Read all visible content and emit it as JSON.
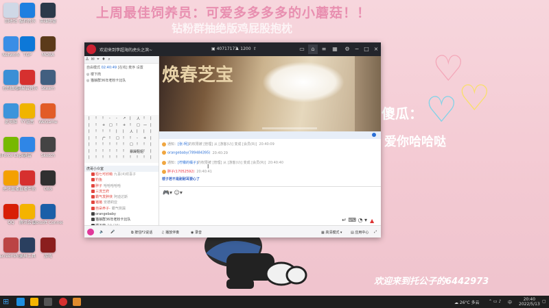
{
  "overlay": {
    "headline": "上周最佳饲养员：可爱多多多多的小蘑菇！！",
    "subline": "钻粉群抽绝版鸡屁股抱枕",
    "deco_line1": "傻瓜：",
    "deco_line2": "爱你哈哈哒",
    "welcome": "欢迎来到托公子的6442973",
    "heart_colors": [
      "#f4a7b9",
      "#7fd3e8",
      "#f9df6a"
    ]
  },
  "desktop_icons": [
    {
      "label": "回收站",
      "color": "#cfd8e6"
    },
    {
      "label": "酷狗音乐",
      "color": "#1e7fe0"
    },
    {
      "label": "英雄联盟",
      "color": "#2b3a4a"
    },
    {
      "label": "Network",
      "color": "#3a8ee6"
    },
    {
      "label": "TGP",
      "color": "#0d78d8"
    },
    {
      "label": "MOBA",
      "color": "#5b3a1a"
    },
    {
      "label": "控制面板",
      "color": "#3b8fd6"
    },
    {
      "label": "网易云音乐",
      "color": "#d6302f"
    },
    {
      "label": "Steam",
      "color": "#425f80"
    },
    {
      "label": "此电脑",
      "color": "#3d94db"
    },
    {
      "label": "YY语音",
      "color": "#f0b400"
    },
    {
      "label": "WeGame",
      "color": "#e25c27"
    },
    {
      "label": "GeForce Experience",
      "color": "#77b900"
    },
    {
      "label": "迅雷",
      "color": "#2f86e6"
    },
    {
      "label": "Sketch",
      "color": "#444"
    },
    {
      "label": "虎牙直播",
      "color": "#f4a000"
    },
    {
      "label": "直播伴侣",
      "color": "#d6302f"
    },
    {
      "label": "OBS",
      "color": "#303030"
    },
    {
      "label": "QQ",
      "color": "#d81e06"
    },
    {
      "label": "腾讯会议",
      "color": "#f4b300"
    },
    {
      "label": "Ubisoft Connect",
      "color": "#1b5fa8"
    },
    {
      "label": "screenshot",
      "color": "#b44"
    },
    {
      "label": "录屏工具",
      "color": "#2a3f5f"
    },
    {
      "label": "游戏",
      "color": "#8b1e1e"
    }
  ],
  "window": {
    "title": "欢迎来到李超海的虎头之滨~",
    "room_id": "40717173",
    "fans": "1200",
    "mode_label": "自由模式",
    "mode_time": "02:40:49",
    "mode_links": [
      "[在线]",
      "麦序",
      "设置"
    ],
    "channels": [
      "楼下肉",
      "猫娘群36年老粉卡比队"
    ],
    "grid_rows": [
      [
        "|",
        "!",
        "!",
        "-",
        "-",
        "↗",
        "|",
        "人",
        "!",
        "|"
      ],
      [
        "|",
        "!",
        "+",
        "□",
        "!",
        "+",
        "!",
        "□",
        "一",
        "|"
      ],
      [
        "|",
        "!",
        "!",
        "!",
        "|",
        "|",
        "人",
        "|",
        "|",
        "|"
      ],
      [
        "|",
        "!",
        "广",
        "!",
        "□",
        "!",
        "!",
        "-",
        "+",
        "|"
      ],
      [
        "|",
        "!",
        "!",
        "!",
        "!",
        "!",
        "□",
        "!",
        "!",
        "|"
      ],
      [
        "|",
        "!",
        "!",
        "!",
        "!",
        "!",
        "暴躁姐姐",
        "!",
        "!",
        "|"
      ],
      [
        "|",
        "!",
        "!",
        "!",
        "!",
        "!",
        "!",
        "!",
        "!",
        "|"
      ]
    ],
    "member_header": "虎哥小众室",
    "members": [
      {
        "name": "柏七可欣萌",
        "note": "九喜(4)欢喜子",
        "color": "#e2463f"
      },
      {
        "name": "钓鱼",
        "note": "",
        "color": "#e2463f"
      },
      {
        "name": "胖子",
        "note": "哈哈哈哈哈",
        "color": "#e2463f"
      },
      {
        "name": "三流王府",
        "note": "",
        "color": "#e2463f"
      },
      {
        "name": "霸气发胖侠",
        "note": "阿迪达斯",
        "color": "#e2463f"
      },
      {
        "name": "猪猪",
        "note": "安德莉亚",
        "color": "#e2463f"
      },
      {
        "name": "芭朵养子-",
        "note": "霸气侧漏",
        "color": "#e2463f"
      },
      {
        "name": "orangebaby",
        "note": "",
        "color": "#444"
      },
      {
        "name": "猫娘群36年老粉卡比队",
        "note": "",
        "color": "#444"
      },
      {
        "name": "楼下肉",
        "note": "7九(26)",
        "color": "#444"
      }
    ],
    "banner_title": "焕春芝宝",
    "chat": [
      {
        "prefix": "通知：",
        "name": "[张-柯]",
        "text": "的权限被 [管理] 从 [游客(U)] 变成 [会员(R)]",
        "time": "20:40:09"
      },
      {
        "prefix": "",
        "name": "orangebaby(789484395)",
        "text": "",
        "time": "20:40:29"
      },
      {
        "prefix": "通知：",
        "name": "[柠檬的橘子]",
        "text": "的权限被 [管理] 从 [游客(U)] 变成 [会员(R)]",
        "time": "20:40:40"
      },
      {
        "prefix": "",
        "name": "胖子(17052592)",
        "text": "",
        "time": "20:40:41"
      }
    ],
    "chat_message": "楼子若不是耐耐耳要心了",
    "bottom": {
      "mic": "按住F2说话",
      "music": "播放伴奏",
      "record": "录音",
      "quality": "高清模式",
      "apps": "应用中心"
    }
  },
  "taskbar": {
    "weather": "26°C 多云",
    "ime": "中",
    "time": "20:40",
    "date": "2022/5/13"
  }
}
